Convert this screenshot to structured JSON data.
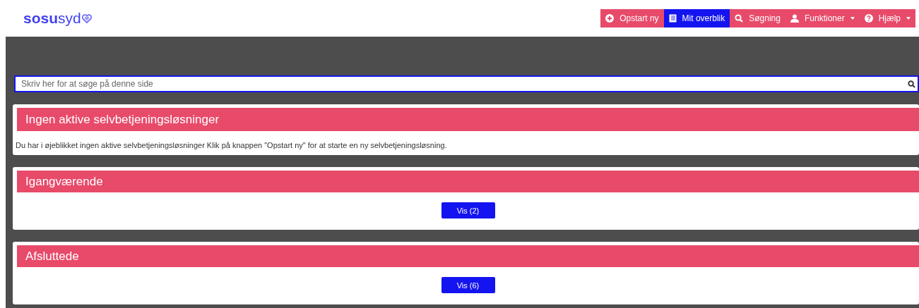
{
  "logo": {
    "text": "**sosu**syd"
  },
  "nav": [
    {
      "label": "Opstart ny",
      "selected": false,
      "dropdown": false
    },
    {
      "label": "Mit overblik",
      "selected": true,
      "dropdown": false
    },
    {
      "label": "Søgning",
      "selected": false,
      "dropdown": false
    },
    {
      "label": "Funktioner",
      "selected": false,
      "dropdown": true
    },
    {
      "label": "Hjælp",
      "selected": false,
      "dropdown": true
    }
  ],
  "search": {
    "placeholder": "Skriv her for at søge på denne side"
  },
  "sections": [
    {
      "kind": "message",
      "title": "Ingen aktive selvbetjeningsløsninger",
      "text": "Du har i øjeblikket ingen aktive selvbetjeningsløsninger Klik på knappen \"Opstart ny\" for at starte en ny selvbetjeningsløsning."
    },
    {
      "kind": "button",
      "title": "Igangværende",
      "button": "Vis (2)"
    },
    {
      "kind": "button",
      "title": "Afsluttede",
      "button": "Vis (6)"
    }
  ]
}
